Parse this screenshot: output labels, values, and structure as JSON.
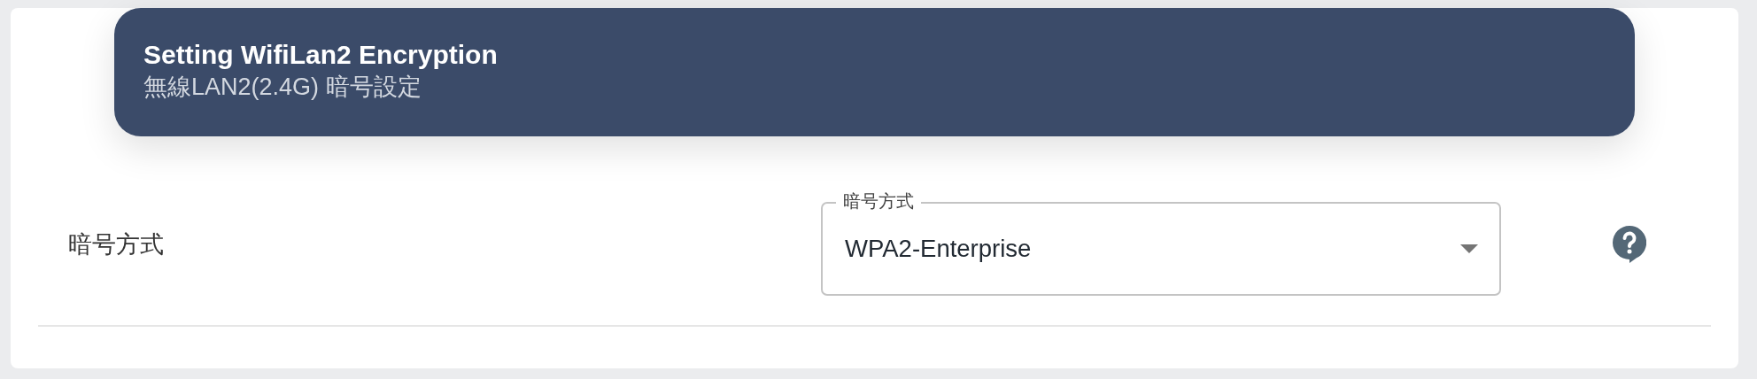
{
  "header": {
    "title": "Setting WifiLan2 Encryption",
    "subtitle": "無線LAN2(2.4G) 暗号設定"
  },
  "setting": {
    "label": "暗号方式",
    "select": {
      "label": "暗号方式",
      "value": "WPA2-Enterprise"
    }
  }
}
